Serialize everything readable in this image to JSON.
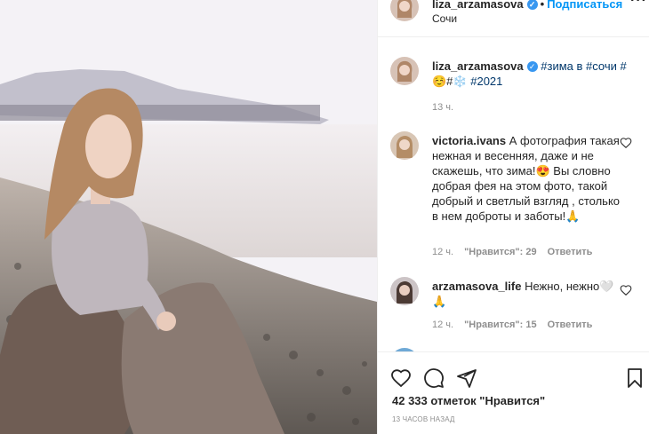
{
  "post": {
    "author": "liza_arzamasova",
    "follow_label": "Подписаться",
    "location": "Сочи",
    "caption_user": "liza_arzamasova",
    "caption_tags": "#зима в #сочи #",
    "caption_line2_emoji": "☺️#❄️",
    "caption_line2_tag": "#2021",
    "caption_time": "13 ч.",
    "likes": "42 333 отметок \"Нравится\"",
    "posted": "13 часов назад"
  },
  "comments": [
    {
      "user": "victoria.ivans",
      "text": "А фотография такая нежная и весенняя, даже и не скажешь, что зима!😍 Вы словно добрая фея на этом фото, такой добрый и светлый взгляд , столько в нем доброты и заботы!🙏",
      "time": "12 ч.",
      "likes": "\"Нравится\": 29",
      "reply": "Ответить"
    },
    {
      "user": "arzamasova_life",
      "text": "Нежно, нежно🤍 🙏",
      "time": "12 ч.",
      "likes": "\"Нравится\": 15",
      "reply": "Ответить"
    }
  ],
  "icons": {
    "like": "heart-icon",
    "comment": "comment-icon",
    "share": "share-icon",
    "save": "bookmark-icon",
    "verified": "verified-badge-icon",
    "more": "more-options-icon"
  },
  "colors": {
    "accent": "#0095f6",
    "verified": "#3897f0",
    "link": "#00376b",
    "muted": "#8e8e8e"
  }
}
